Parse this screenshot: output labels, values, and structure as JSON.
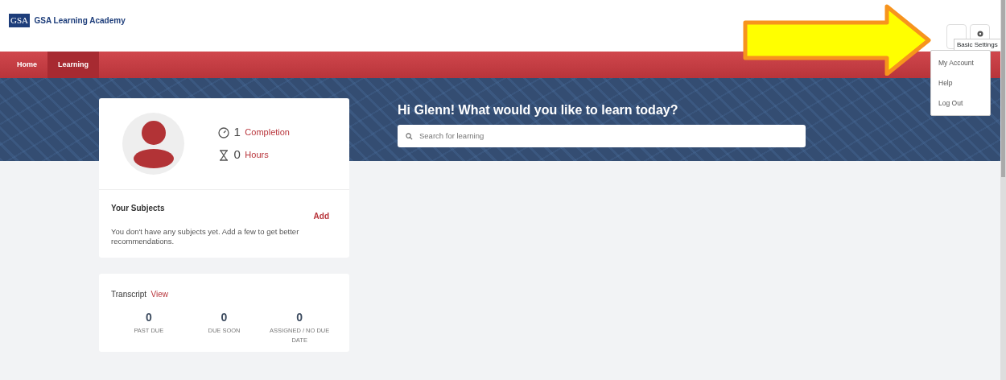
{
  "logo": {
    "badge": "GSA",
    "title": "GSA Learning Academy"
  },
  "nav": [
    {
      "label": "Home",
      "selected": false
    },
    {
      "label": "Learning",
      "selected": true
    }
  ],
  "tooltip": "Basic Settings",
  "menu": [
    {
      "label": "My Account"
    },
    {
      "label": "Help"
    },
    {
      "label": "Log Out"
    }
  ],
  "hero": {
    "heading": "Hi Glenn! What would you like to learn today?",
    "search": {
      "placeholder": "Search for learning"
    }
  },
  "profile": {
    "stats": [
      {
        "kind": "completion",
        "value": "1",
        "label": "Completion"
      },
      {
        "kind": "hours",
        "value": "0",
        "label": "Hours"
      }
    ]
  },
  "subjects": {
    "title": "Your Subjects",
    "action": "Add",
    "message": "You don't have any subjects yet. Add a few to get better recommendations."
  },
  "transcript": {
    "title": "Transcript",
    "link": "View",
    "stats": [
      {
        "value": "0",
        "label": "PAST DUE"
      },
      {
        "value": "0",
        "label": "DUE SOON"
      },
      {
        "value": "0",
        "label": "ASSIGNED / NO DUE DATE"
      }
    ]
  }
}
